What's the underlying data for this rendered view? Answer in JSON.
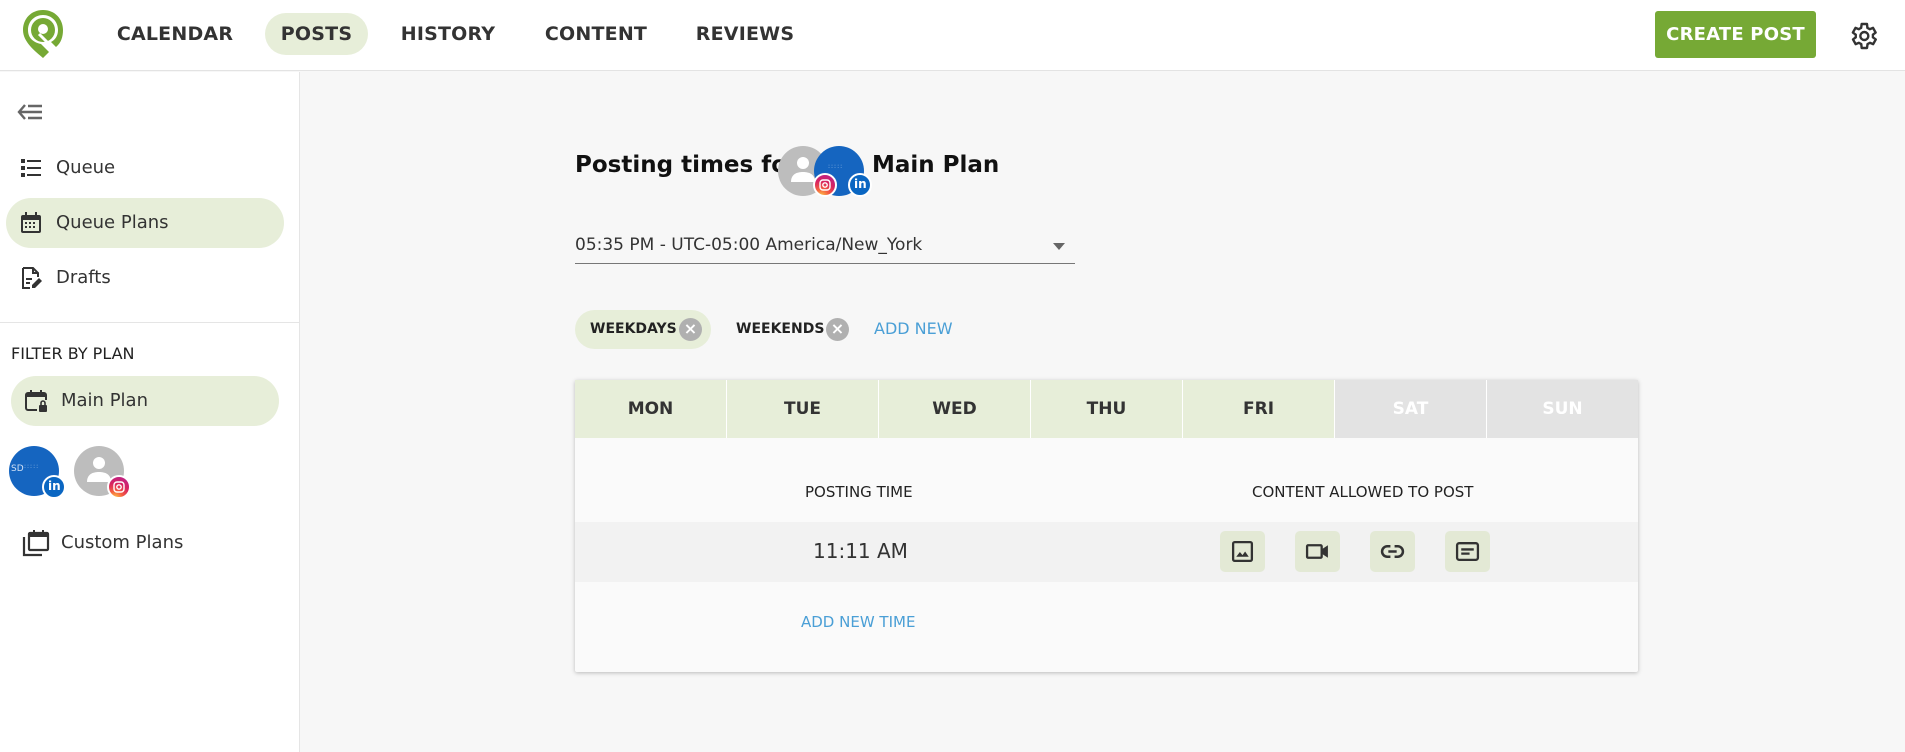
{
  "colors": {
    "brand": "#76a935",
    "active_bg": "#e7eed9",
    "link": "#4a9fd6",
    "linkedin": "#0a66c2"
  },
  "topbar": {
    "logo": "location-pin-logo",
    "tabs": [
      {
        "label": "CALENDAR",
        "active": false
      },
      {
        "label": "POSTS",
        "active": true
      },
      {
        "label": "HISTORY",
        "active": false
      },
      {
        "label": "CONTENT",
        "active": false
      },
      {
        "label": "REVIEWS",
        "active": false
      }
    ],
    "create_label": "CREATE POST",
    "settings_icon": "gear-icon"
  },
  "sidebar": {
    "collapse_icon": "collapse-left-icon",
    "items": [
      {
        "label": "Queue",
        "icon": "list-icon",
        "active": false
      },
      {
        "label": "Queue Plans",
        "icon": "calendar-icon",
        "active": true
      },
      {
        "label": "Drafts",
        "icon": "draft-edit-icon",
        "active": false
      }
    ],
    "filter_title": "FILTER BY PLAN",
    "plans": [
      {
        "label": "Main Plan",
        "icon": "calendar-lock-icon",
        "active": true
      },
      {
        "label": "Custom Plans",
        "icon": "calendar-stack-icon",
        "active": false
      }
    ],
    "accounts": [
      {
        "initials": "SD",
        "network": "linkedin"
      },
      {
        "initials": "",
        "network": "instagram"
      }
    ]
  },
  "main": {
    "heading": "Posting times for:",
    "plan_name": "Main Plan",
    "timezone": "05:35 PM - UTC-05:00 America/New_York",
    "schedules": [
      {
        "label": "WEEKDAYS",
        "active": true
      },
      {
        "label": "WEEKENDS",
        "active": false
      }
    ],
    "add_new_label": "ADD NEW",
    "days": [
      {
        "label": "MON",
        "enabled": true
      },
      {
        "label": "TUE",
        "enabled": true
      },
      {
        "label": "WED",
        "enabled": true
      },
      {
        "label": "THU",
        "enabled": true
      },
      {
        "label": "FRI",
        "enabled": true
      },
      {
        "label": "SAT",
        "enabled": false
      },
      {
        "label": "SUN",
        "enabled": false
      }
    ],
    "posting_time_header": "POSTING TIME",
    "content_header": "CONTENT ALLOWED TO POST",
    "times": [
      {
        "time": "11:11 AM",
        "content_types": [
          "image-icon",
          "video-icon",
          "link-icon",
          "text-icon"
        ]
      }
    ],
    "add_time_label": "ADD NEW TIME"
  }
}
